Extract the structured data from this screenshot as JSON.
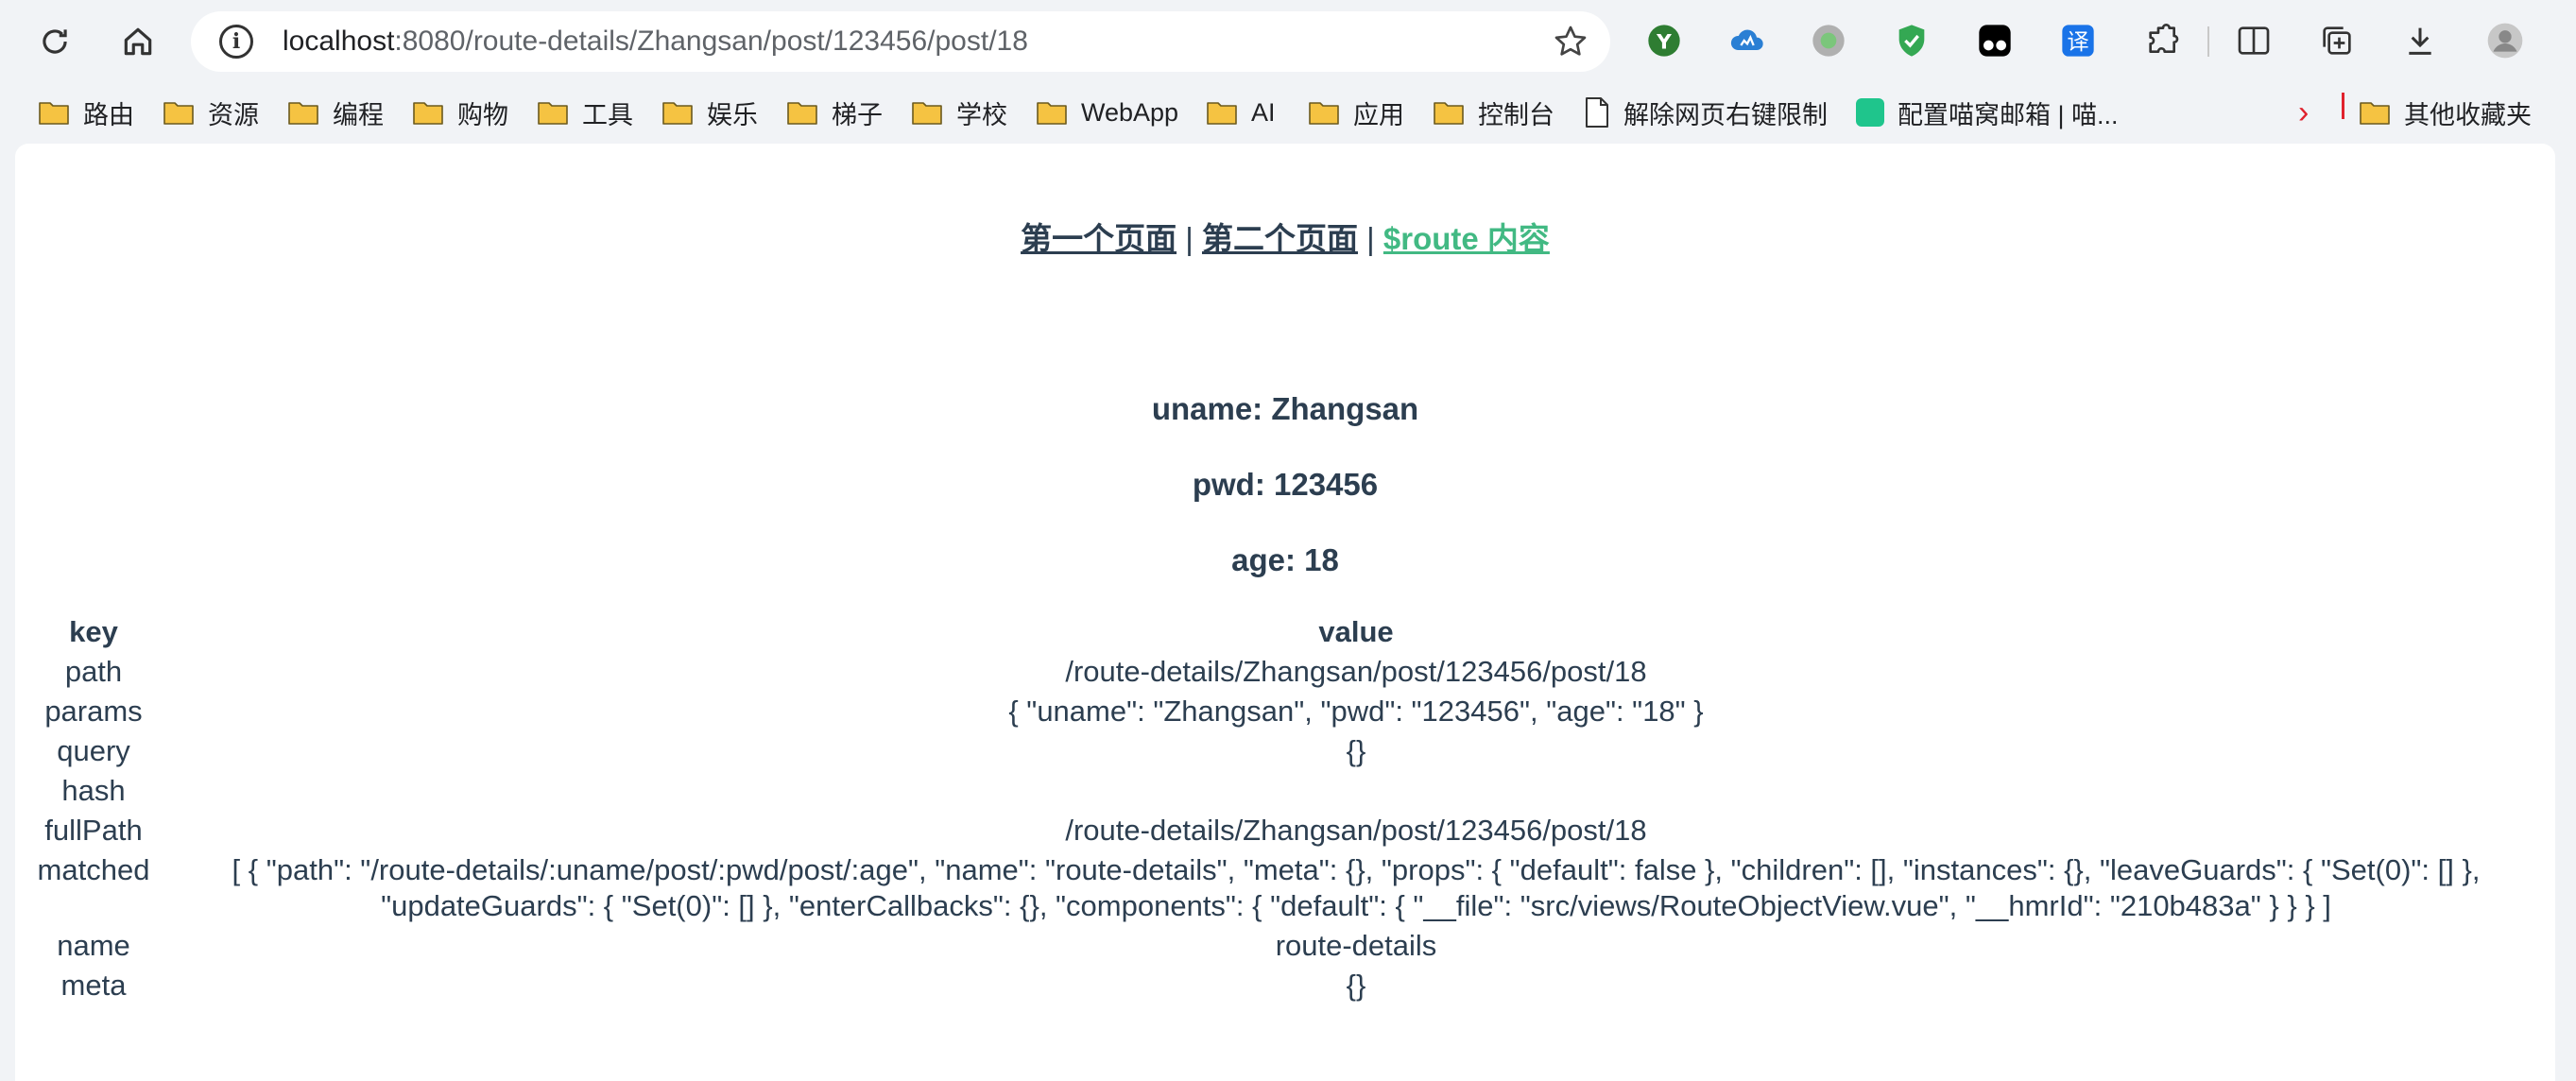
{
  "browser": {
    "url_host": "localhost",
    "url_path": ":8080/route-details/Zhangsan/post/123456/post/18"
  },
  "bookmarks": [
    {
      "label": "路由",
      "icon": "folder-icon"
    },
    {
      "label": "资源",
      "icon": "folder-icon"
    },
    {
      "label": "编程",
      "icon": "folder-icon"
    },
    {
      "label": "购物",
      "icon": "folder-icon"
    },
    {
      "label": "工具",
      "icon": "folder-icon"
    },
    {
      "label": "娱乐",
      "icon": "folder-icon"
    },
    {
      "label": "梯子",
      "icon": "folder-icon"
    },
    {
      "label": "学校",
      "icon": "folder-icon"
    },
    {
      "label": "WebApp",
      "icon": "folder-icon"
    },
    {
      "label": "AI",
      "icon": "folder-icon"
    },
    {
      "label": "应用",
      "icon": "folder-icon"
    },
    {
      "label": "控制台",
      "icon": "folder-icon"
    },
    {
      "label": "解除网页右键限制",
      "icon": "page-icon"
    },
    {
      "label": "配置喵窝邮箱 | 喵...",
      "icon": "green-app-icon"
    }
  ],
  "other_bookmarks": "其他收藏夹",
  "nav": {
    "link1": "第一个页面",
    "link2": "第二个页面",
    "link3": "$route 内容",
    "separator": "|"
  },
  "info": {
    "uname": "uname: Zhangsan",
    "pwd": "pwd: 123456",
    "age": "age: 18"
  },
  "table": {
    "headers": {
      "key": "key",
      "value": "value"
    },
    "rows": [
      {
        "key": "path",
        "value": "/route-details/Zhangsan/post/123456/post/18"
      },
      {
        "key": "params",
        "value": "{ \"uname\": \"Zhangsan\", \"pwd\": \"123456\", \"age\": \"18\" }"
      },
      {
        "key": "query",
        "value": "{}"
      },
      {
        "key": "hash",
        "value": ""
      },
      {
        "key": "fullPath",
        "value": "/route-details/Zhangsan/post/123456/post/18"
      },
      {
        "key": "matched",
        "value": "[ { \"path\": \"/route-details/:uname/post/:pwd/post/:age\", \"name\": \"route-details\", \"meta\": {}, \"props\": { \"default\": false }, \"children\": [], \"instances\": {}, \"leaveGuards\": { \"Set(0)\": [] }, \"updateGuards\": { \"Set(0)\": [] }, \"enterCallbacks\": {}, \"components\": { \"default\": { \"__file\": \"src/views/RouteObjectView.vue\", \"__hmrId\": \"210b483a\" } } } ]"
      },
      {
        "key": "name",
        "value": "route-details"
      },
      {
        "key": "meta",
        "value": "{}"
      }
    ]
  },
  "colors": {
    "text": "#2c3e50",
    "active_link": "#42b983",
    "folder": "#f5c342",
    "chrome_bg": "#f1f3f6"
  }
}
